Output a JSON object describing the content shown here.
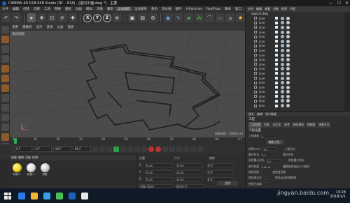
{
  "window": {
    "title": "CINEMA 4D R18.048 Studio (RC - R18) - [室内平面.dwg *] - 主要",
    "controls": [
      "—",
      "☐",
      "✕"
    ]
  },
  "menubar": {
    "items": [
      "文件",
      "编辑",
      "创建",
      "选择",
      "工具",
      "网格",
      "捕捉",
      "动画",
      "模拟",
      "渲染",
      "雕刻",
      "运动跟踪",
      "运动图形",
      "角色",
      "流水线",
      "插件",
      "X-Particles",
      "RealFlow",
      "脚本",
      "窗口",
      "帮助"
    ]
  },
  "toolbar": {
    "axis_x": "X",
    "axis_y": "Y",
    "axis_z": "Z"
  },
  "viewport": {
    "menu": [
      "查看",
      "摄像机",
      "显示",
      "选项",
      "过滤",
      "面板"
    ],
    "label": "透视视图",
    "grid_scale": "网格间距：10000 cm"
  },
  "timeline": {
    "ticks": [
      "0",
      "10",
      "20",
      "30",
      "40",
      "50",
      "60",
      "70",
      "80",
      "90"
    ],
    "end_frame": "0 F"
  },
  "transport": {
    "start_field": "0 F",
    "current_field": "0 F",
    "end_field": "90 F",
    "max_field": "90 F"
  },
  "material_manager": {
    "menu": [
      "创建",
      "编辑",
      "功能",
      "纹理"
    ],
    "materials": [
      {
        "label": "材质.2",
        "color": "#e8d41a"
      },
      {
        "label": "材质.1",
        "color": "#e8e8e8"
      },
      {
        "label": "材质",
        "color": "#d8d8d8"
      }
    ]
  },
  "coordinates": {
    "headers": [
      "位置",
      "尺寸",
      "旋转"
    ],
    "rows": [
      {
        "axis": "X",
        "pos": "0 cm",
        "size": "0 cm",
        "rot": "H 0°"
      },
      {
        "axis": "Y",
        "pos": "0 cm",
        "size": "0 cm",
        "rot": "P 0°"
      },
      {
        "axis": "Z",
        "pos": "0 cm",
        "size": "0 cm",
        "rot": "B 0°"
      }
    ],
    "mode": "对象 (相对)",
    "size_mode": "绝对尺寸",
    "apply": "应用"
  },
  "objects": {
    "tabs": [
      "文件",
      "编辑",
      "查看",
      "对象",
      "标签",
      "书签"
    ],
    "root": "objects.dwg",
    "items": [
      "Line",
      "Line",
      "Line",
      "Line",
      "Line",
      "Line",
      "Line",
      "Line",
      "Line",
      "Line",
      "Line",
      "Line",
      "Line",
      "Line",
      "Line",
      "Line",
      "Line",
      "Line",
      "Line",
      "Line"
    ]
  },
  "attributes": {
    "menu": [
      "模式",
      "编辑",
      "用户数据"
    ],
    "section": "工程",
    "subtabs": [
      "工程设置",
      "信息",
      "动力学",
      "参考",
      "待办事项",
      "帧插值",
      "场景节点"
    ],
    "subsection": "工程设置",
    "rows": [
      {
        "label": "工程缩放",
        "value": "1"
      },
      {
        "label": "帧率(FPS)",
        "value": "30"
      },
      {
        "label": "最小时长",
        "value": "0 F"
      },
      {
        "label": "预览最小时长",
        "value": "0 F"
      },
      {
        "label": "细节程度",
        "value": "100 %"
      },
      {
        "label": "使用动画",
        "value": ""
      },
      {
        "label": "使用表达式",
        "value": ""
      },
      {
        "label": "使用生成器",
        "value": ""
      }
    ],
    "right_labels": [
      "工程时长",
      "最大时长",
      "预览最大时长",
      "编辑使用渲染LOD级别",
      "使用变形器",
      "使用运动剪辑系统"
    ],
    "scale_button": "缩放工程..."
  },
  "taskbar": {
    "time": "13:28",
    "date": "2018/1/1",
    "watermark": "jingyan.baidu.com",
    "icon_colors": [
      "#2a7be4",
      "#f4b43a",
      "#3aa0e8",
      "#4bbf57",
      "#1b5fbf",
      "#e8e8e8"
    ]
  }
}
